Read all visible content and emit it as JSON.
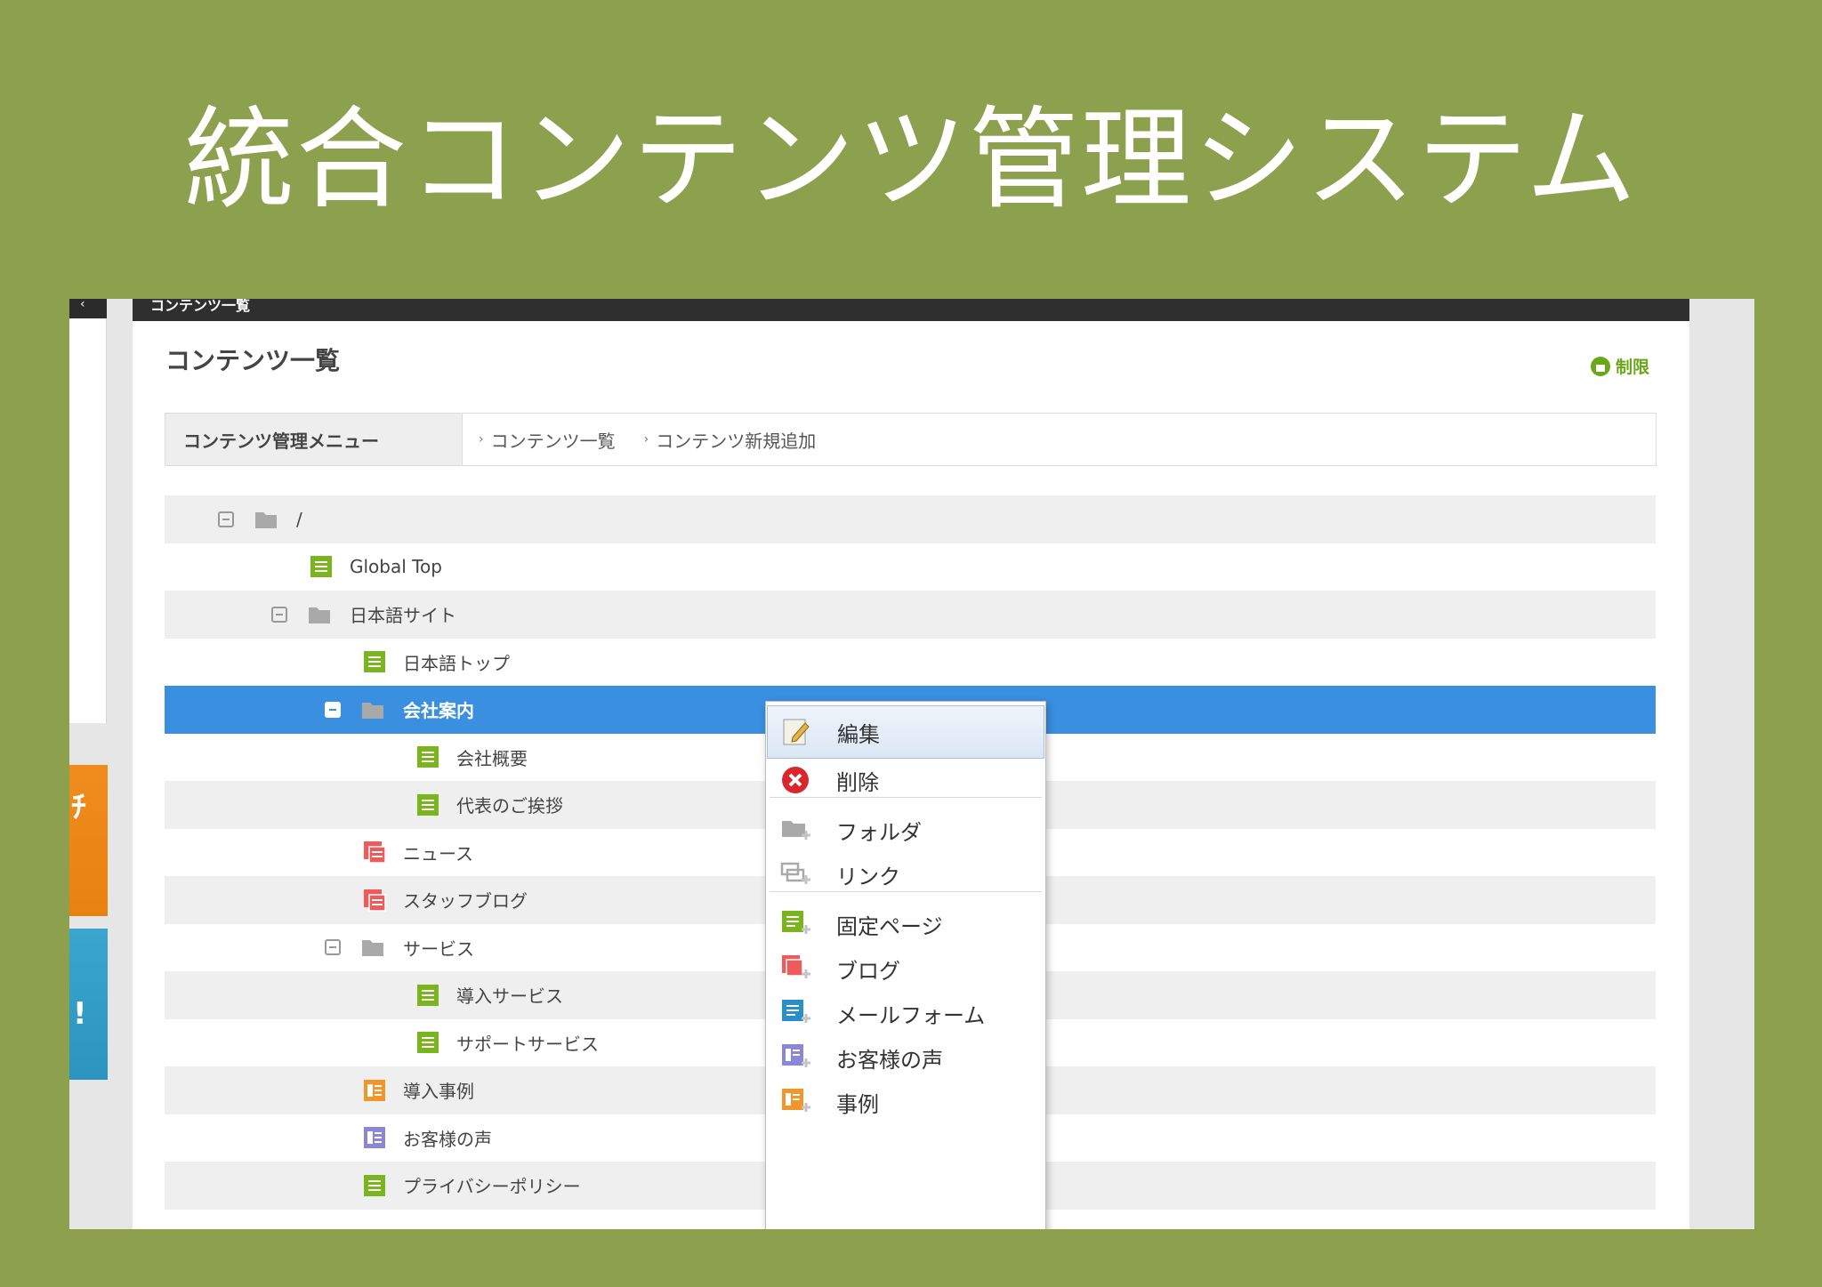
{
  "hero": {
    "title": "統合コンテンツ管理システム"
  },
  "app": {
    "topbar_title": "コンテンツ一覧",
    "page_title": "コンテンツ一覧",
    "restrict_label": "制限",
    "menu": {
      "title": "コンテンツ管理メニュー",
      "links": [
        "コンテンツ一覧",
        "コンテンツ新規追加"
      ]
    }
  },
  "tree": [
    {
      "label": "/",
      "icon": "folder-icon",
      "level": 0,
      "toggle": true
    },
    {
      "label": "Global Top",
      "icon": "page-icon-green",
      "level": 1,
      "toggle": false
    },
    {
      "label": "日本語サイト",
      "icon": "folder-icon",
      "level": 1,
      "toggle": true
    },
    {
      "label": "日本語トップ",
      "icon": "page-icon-green",
      "level": 2,
      "toggle": false
    },
    {
      "label": "会社案内",
      "icon": "folder-icon",
      "level": 2,
      "toggle": true,
      "selected": true
    },
    {
      "label": "会社概要",
      "icon": "page-icon-green",
      "level": 3,
      "toggle": false
    },
    {
      "label": "代表のご挨拶",
      "icon": "page-icon-green",
      "level": 3,
      "toggle": false
    },
    {
      "label": "ニュース",
      "icon": "blog-icon-red",
      "level": 2,
      "toggle": false
    },
    {
      "label": "スタッフブログ",
      "icon": "blog-icon-red",
      "level": 2,
      "toggle": false
    },
    {
      "label": "サービス",
      "icon": "folder-icon",
      "level": 2,
      "toggle": true
    },
    {
      "label": "導入サービス",
      "icon": "page-icon-green",
      "level": 3,
      "toggle": false
    },
    {
      "label": "サポートサービス",
      "icon": "page-icon-green",
      "level": 3,
      "toggle": false
    },
    {
      "label": "導入事例",
      "icon": "case-icon-orange",
      "level": 2,
      "toggle": false
    },
    {
      "label": "お客様の声",
      "icon": "voice-icon-purple",
      "level": 2,
      "toggle": false
    },
    {
      "label": "プライバシーポリシー",
      "icon": "page-icon-green",
      "level": 2,
      "toggle": false
    }
  ],
  "context_menu": [
    {
      "label": "編集",
      "icon": "edit-icon"
    },
    {
      "label": "削除",
      "icon": "delete-icon"
    },
    {
      "label": "フォルダ",
      "icon": "add-folder-icon"
    },
    {
      "label": "リンク",
      "icon": "add-link-icon"
    },
    {
      "label": "固定ページ",
      "icon": "add-page-icon"
    },
    {
      "label": "ブログ",
      "icon": "add-blog-icon"
    },
    {
      "label": "メールフォーム",
      "icon": "add-mailform-icon"
    },
    {
      "label": "お客様の声",
      "icon": "add-voice-icon"
    },
    {
      "label": "事例",
      "icon": "add-case-icon"
    }
  ],
  "colors": {
    "background": "#8da04e",
    "selected_row": "#3a8fe0",
    "green_icon": "#7ab51d",
    "red_icon": "#ee5b5b",
    "orange_icon": "#f0962a",
    "purple_icon": "#8a86d8",
    "blue_icon": "#2a8ec9"
  }
}
